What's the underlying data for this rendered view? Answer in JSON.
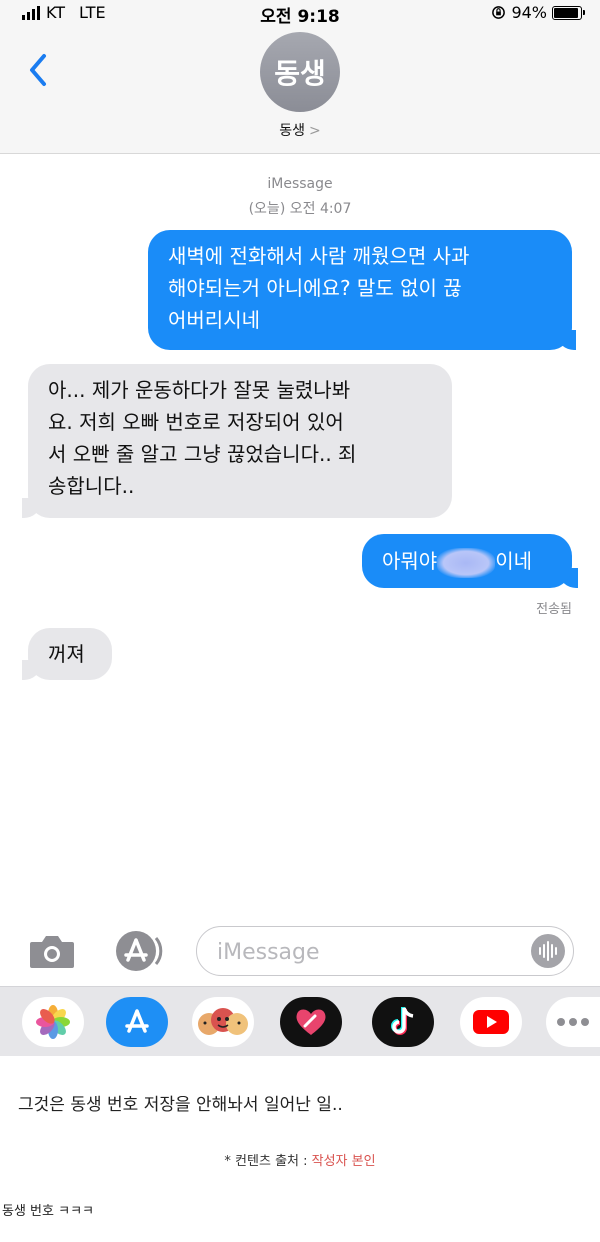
{
  "status_bar": {
    "carrier": "KT",
    "network": "LTE",
    "time": "오전 9:18",
    "battery": "94%",
    "battery_level": 0.94
  },
  "header": {
    "back_icon": "chevron-left-icon",
    "avatar_text": "동생",
    "contact_name": "동생",
    "contact_chevron": ">"
  },
  "thread": {
    "service_label": "iMessage",
    "timestamp": "(오늘) 오전 4:07",
    "messages": [
      {
        "direction": "out",
        "lines": [
          "새벽에 전화해서 사람 깨웠으면 사과",
          "해야되는거 아니에요? 말도 없이 끊",
          "어버리시네"
        ]
      },
      {
        "direction": "in",
        "lines": [
          "아... 제가 운동하다가 잘못 눌렸나봐",
          "요. 저희 오빠 번호로 저장되어 있어",
          "서 오빤 줄 알고 그냥 끊었습니다.. 죄",
          "송합니다.."
        ]
      },
      {
        "direction": "out",
        "before_redaction": "아뭐야",
        "after_redaction": "이네"
      },
      {
        "direction": "in",
        "lines": [
          "꺼져"
        ]
      }
    ],
    "delivered_label": "전송됨"
  },
  "input_bar": {
    "camera_icon": "camera-icon",
    "apps_icon": "app-store-icon",
    "placeholder": "iMessage",
    "voice_icon": "waveform-icon"
  },
  "app_drawer": {
    "apps": [
      "photos-icon",
      "app-store-icon",
      "memoji-icon",
      "digital-touch-icon",
      "tiktok-icon",
      "youtube-icon",
      "more-icon"
    ]
  },
  "caption": "그것은 동생 번호 저장을 안해놔서 일어난 일..",
  "source": {
    "prefix": "* 컨텐츠 출처 : ",
    "author": "작성자 본인"
  },
  "footer_note": "동생 번호 ㅋㅋㅋ",
  "colors": {
    "outgoing_bubble": "#1a8cf8",
    "incoming_bubble": "#e7e7ea",
    "accent_blue": "#1a7cf0",
    "source_author": "#d9534f"
  }
}
